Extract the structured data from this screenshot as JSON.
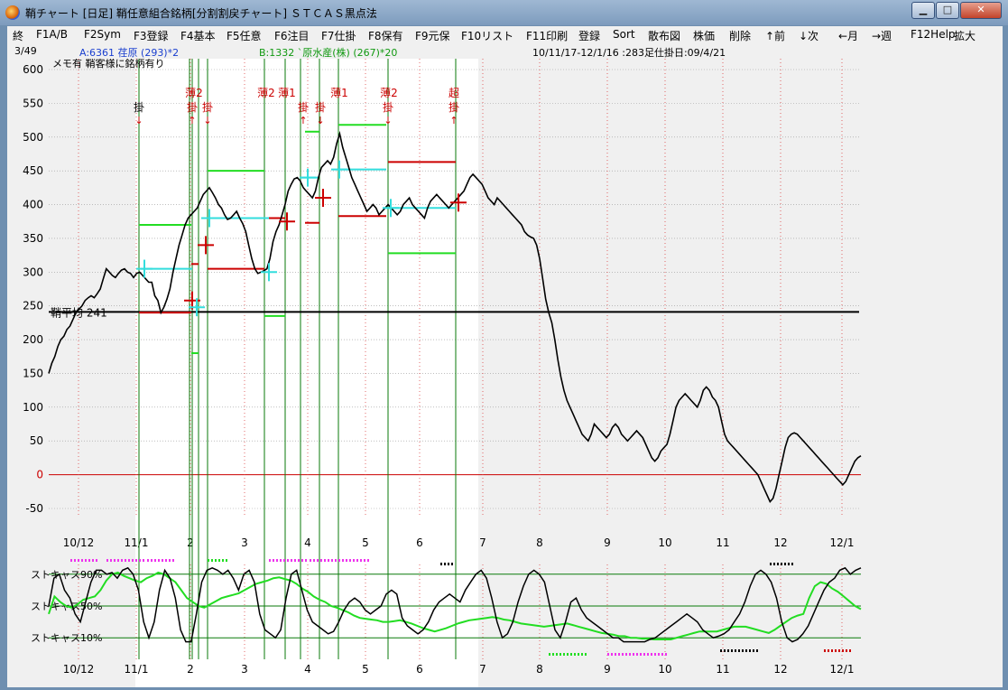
{
  "window": {
    "title": "鞘チャート [日足] 鞘任意組合銘柄[分割割戻チャート] ＳＴＣＡＳ黒点法",
    "minimize_label": "▁",
    "maximize_label": "□",
    "close_label": "✕"
  },
  "menu": [
    "終",
    "F1A/B",
    "F2Sym",
    "F3登録",
    "F4基本",
    "F5任意",
    "F6注目",
    "F7仕掛",
    "F8保有",
    "F9元保",
    "F10リスト",
    "F11印刷",
    "登録",
    "Sort",
    "散布図",
    "株価",
    "削除",
    "↑前",
    "↓次",
    "←月",
    "→週",
    "F12Help",
    "拡大"
  ],
  "info": {
    "counter": "3/49",
    "a_symbol": "A:6361 荏原 (293)*2",
    "b_symbol": "B:1332 `原水産(株) (267)*20",
    "period": "10/11/17-12/1/16 :283足仕掛日:09/4/21",
    "memo": "メモ有 鞘客様に銘柄有り"
  },
  "colors": {
    "price_line": "#000000",
    "zero_line": "#cc0000",
    "cyan": "#33dddd",
    "red": "#cc0000",
    "green": "#22dd22",
    "vline": "#0a7a0a",
    "dotted_vline": "#dd4444",
    "magenta": "#ee33ee"
  },
  "chart_data": {
    "type": "line",
    "ylim": [
      -70,
      610
    ],
    "yticks": [
      600,
      550,
      500,
      450,
      400,
      350,
      300,
      250,
      200,
      150,
      100,
      50,
      0,
      -50
    ],
    "x_tick_labels": [
      "10/12",
      "11/1",
      "2",
      "3",
      "4",
      "5",
      "6",
      "7",
      "8",
      "9",
      "10",
      "11",
      "12",
      "12/1"
    ],
    "average_label": "鞘平均 241",
    "average_value": 241,
    "series": [
      {
        "values": [
          150,
          165,
          175,
          190,
          200,
          205,
          215,
          220,
          230,
          240,
          245,
          250,
          258,
          262,
          265,
          262,
          268,
          275,
          290,
          305,
          300,
          295,
          292,
          298,
          303,
          305,
          300,
          298,
          292,
          298,
          300,
          295,
          290,
          285,
          285,
          265,
          258,
          240,
          248,
          260,
          275,
          300,
          320,
          340,
          355,
          370,
          380,
          385,
          390,
          395,
          405,
          415,
          420,
          425,
          418,
          410,
          400,
          395,
          385,
          378,
          380,
          385,
          390,
          380,
          372,
          360,
          340,
          320,
          305,
          298,
          300,
          302,
          305,
          320,
          345,
          360,
          370,
          385,
          400,
          420,
          430,
          438,
          440,
          435,
          425,
          420,
          415,
          410,
          420,
          440,
          455,
          460,
          465,
          460,
          470,
          490,
          505,
          485,
          470,
          455,
          440,
          430,
          420,
          410,
          400,
          390,
          395,
          400,
          395,
          385,
          390,
          395,
          400,
          395,
          390,
          385,
          390,
          400,
          405,
          410,
          400,
          395,
          390,
          385,
          380,
          395,
          405,
          410,
          415,
          410,
          405,
          400,
          395,
          400,
          405,
          410,
          415,
          420,
          430,
          440,
          445,
          440,
          435,
          430,
          420,
          410,
          405,
          400,
          410,
          405,
          400,
          395,
          390,
          385,
          380,
          375,
          370,
          360,
          355,
          352,
          350,
          340,
          320,
          290,
          260,
          240,
          225,
          200,
          170,
          145,
          125,
          110,
          100,
          90,
          80,
          70,
          60,
          55,
          50,
          60,
          75,
          70,
          65,
          60,
          55,
          60,
          70,
          75,
          70,
          60,
          55,
          50,
          55,
          60,
          65,
          60,
          55,
          45,
          35,
          25,
          20,
          25,
          35,
          40,
          45,
          60,
          80,
          100,
          110,
          115,
          120,
          115,
          110,
          105,
          100,
          110,
          125,
          130,
          125,
          115,
          110,
          100,
          80,
          60,
          50,
          45,
          40,
          35,
          30,
          25,
          20,
          15,
          10,
          5,
          0,
          -10,
          -20,
          -30,
          -40,
          -35,
          -20,
          0,
          20,
          40,
          55,
          60,
          62,
          60,
          55,
          50,
          45,
          40,
          35,
          30,
          25,
          20,
          15,
          10,
          5,
          0,
          -5,
          -10,
          -15,
          -10,
          0,
          10,
          20,
          25,
          28
        ],
        "color": "#000000"
      },
      {
        "values": [
          40,
          62,
          55,
          50,
          48,
          52,
          58,
          60,
          62,
          70,
          82,
          90,
          92,
          88,
          85,
          82,
          80,
          85,
          88,
          92,
          90,
          85,
          80,
          70,
          60,
          55,
          50,
          48,
          52,
          56,
          60,
          62,
          64,
          66,
          70,
          74,
          78,
          80,
          82,
          85,
          86,
          84,
          82,
          78,
          72,
          68,
          62,
          58,
          55,
          50,
          48,
          45,
          42,
          38,
          35,
          34,
          33,
          32,
          30,
          30,
          31,
          32,
          30,
          28,
          25,
          22,
          20,
          18,
          20,
          22,
          25,
          28,
          30,
          32,
          33,
          34,
          35,
          36,
          35,
          33,
          32,
          30,
          28,
          27,
          26,
          25,
          24,
          25,
          26,
          27,
          28,
          26,
          24,
          22,
          20,
          18,
          16,
          15,
          14,
          12,
          12,
          10,
          10,
          9,
          9,
          8,
          8,
          8,
          8,
          10,
          12,
          14,
          16,
          18,
          18,
          18,
          18,
          20,
          22,
          24,
          24,
          24,
          22,
          20,
          18,
          16,
          20,
          25,
          30,
          35,
          38,
          40,
          60,
          75,
          80,
          78,
          72,
          68,
          62,
          56,
          50,
          46
        ],
        "color": "#22dd22"
      },
      {
        "values": [
          50,
          85,
          90,
          70,
          60,
          40,
          30,
          55,
          80,
          95,
          95,
          90,
          92,
          85,
          95,
          98,
          90,
          70,
          30,
          10,
          30,
          70,
          95,
          85,
          60,
          20,
          5,
          5,
          40,
          80,
          95,
          98,
          95,
          90,
          95,
          85,
          70,
          90,
          95,
          80,
          40,
          20,
          15,
          10,
          20,
          60,
          90,
          95,
          70,
          45,
          30,
          25,
          20,
          15,
          18,
          30,
          45,
          55,
          60,
          55,
          45,
          40,
          45,
          50,
          65,
          70,
          65,
          35,
          25,
          20,
          15,
          20,
          30,
          45,
          55,
          60,
          65,
          60,
          55,
          70,
          80,
          90,
          95,
          85,
          60,
          30,
          10,
          15,
          30,
          55,
          75,
          90,
          95,
          90,
          80,
          50,
          20,
          10,
          30,
          55,
          60,
          45,
          35,
          30,
          25,
          20,
          15,
          10,
          10,
          5,
          5,
          5,
          5,
          5,
          8,
          10,
          15,
          20,
          25,
          30,
          35,
          40,
          35,
          30,
          20,
          15,
          10,
          12,
          15,
          20,
          30,
          40,
          55,
          75,
          90,
          95,
          90,
          80,
          60,
          30,
          10,
          5,
          8,
          15,
          25,
          40,
          55,
          70,
          80,
          85,
          95,
          98,
          90,
          95,
          98
        ],
        "color": "#000000"
      }
    ],
    "stochastic_labels": [
      "ストキャス90%",
      "ストキャス50%",
      "ストキャス10%"
    ],
    "signals": [
      {
        "label": "掛",
        "arrow": "↓"
      },
      {
        "label": "薄2",
        "arrow": ""
      },
      {
        "label": "掛",
        "arrow": "↑"
      },
      {
        "label": "掛",
        "arrow": "↓"
      },
      {
        "label": "薄2",
        "arrow": ""
      },
      {
        "label": "薄1",
        "arrow": ""
      },
      {
        "label": "掛",
        "arrow": "↑"
      },
      {
        "label": "掛",
        "arrow": "↓"
      },
      {
        "label": "薄1",
        "arrow": ""
      },
      {
        "label": "掛",
        "arrow": "↓"
      },
      {
        "label": "薄2",
        "arrow": ""
      },
      {
        "label": "掛",
        "arrow": "↑"
      },
      {
        "label": "超",
        "arrow": ""
      }
    ]
  }
}
